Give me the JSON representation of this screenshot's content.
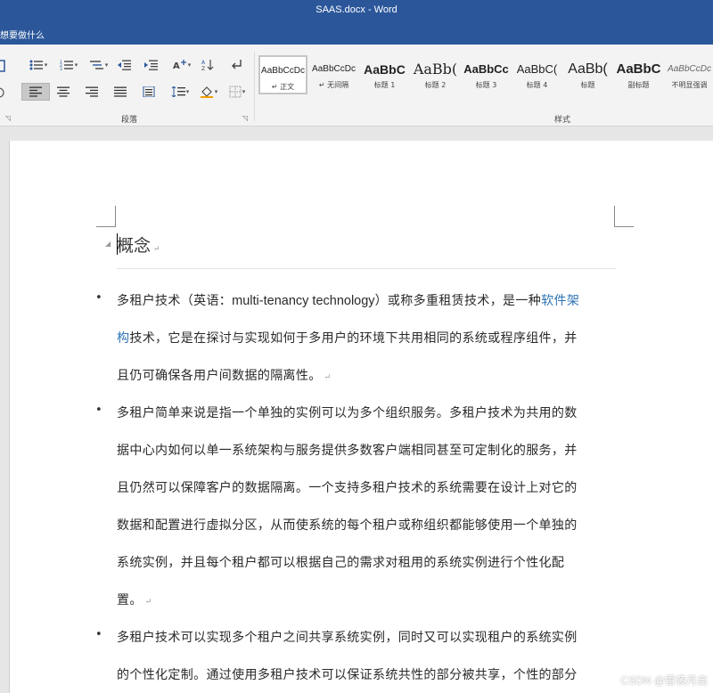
{
  "window": {
    "title": "SAAS.docx - Word"
  },
  "tell_me": {
    "placeholder": "想要做什么"
  },
  "ribbon": {
    "paragraph_group_label": "段落",
    "styles_group_label": "样式",
    "styles": [
      {
        "sample": "AaBbCcDc",
        "name": "↵ 正文",
        "selected": true
      },
      {
        "sample": "AaBbCcDc",
        "name": "↵ 无间隔"
      },
      {
        "sample": "AaBbC",
        "name": "标题 1"
      },
      {
        "sample": "AaBb(",
        "name": "标题 2"
      },
      {
        "sample": "AaBbCc",
        "name": "标题 3"
      },
      {
        "sample": "AaBbC(",
        "name": "标题 4"
      },
      {
        "sample": "AaBb(",
        "name": "标题"
      },
      {
        "sample": "AaBbC",
        "name": "副标题"
      },
      {
        "sample": "AaBbCcDc",
        "name": "不明显强调"
      }
    ]
  },
  "document": {
    "heading": "概念",
    "paragraphs": [
      {
        "lines": [
          {
            "parts": [
              {
                "text": "多租户技术（英语："
              },
              {
                "text": "multi-tenancy technology",
                "latin": true
              },
              {
                "text": "）或称多重租赁技术，是一种"
              },
              {
                "text": "软件架",
                "link": true
              }
            ]
          },
          {
            "parts": [
              {
                "text": "构",
                "link": true
              },
              {
                "text": "技术，它是在探讨与实现如何于多用户的环境下共用相同的系统或程序组件，并"
              }
            ]
          },
          {
            "parts": [
              {
                "text": "且仍可确保各用户间数据的隔离性。"
              }
            ],
            "mark": true
          }
        ]
      },
      {
        "lines": [
          {
            "parts": [
              {
                "text": "多租户简单来说是指一个单独的实例可以为多个组织服务。多租户技术为共用的数"
              }
            ]
          },
          {
            "parts": [
              {
                "text": "据中心内如何以单一系统架构与服务提供多数客户端相同甚至可定制化的服务，并"
              }
            ]
          },
          {
            "parts": [
              {
                "text": "且仍然可以保障客户的数据隔离。一个支持多租户技术的系统需要在设计上对它的"
              }
            ]
          },
          {
            "parts": [
              {
                "text": "数据和配置进行虚拟分区，从而使系统的每个租户或称组织都能够使用一个单独的"
              }
            ]
          },
          {
            "parts": [
              {
                "text": "系统实例，并且每个租户都可以根据自己的需求对租用的系统实例进行个性化配"
              }
            ]
          },
          {
            "parts": [
              {
                "text": "置。"
              }
            ],
            "mark": true
          }
        ]
      },
      {
        "lines": [
          {
            "parts": [
              {
                "text": "多租户技术可以实现多个租户之间共享系统实例，同时又可以实现租户的系统实例"
              }
            ]
          },
          {
            "parts": [
              {
                "text": "的个性化定制。通过使用多租户技术可以保证系统共性的部分被共享，个性的部分"
              }
            ]
          }
        ]
      }
    ],
    "paragraph_mark": "↵"
  },
  "watermark": "CSDN @雷袭月启",
  "colors": {
    "titlebar": "#2b579a",
    "link": "#2e74b5",
    "ribbon": "#f3f3f3"
  }
}
